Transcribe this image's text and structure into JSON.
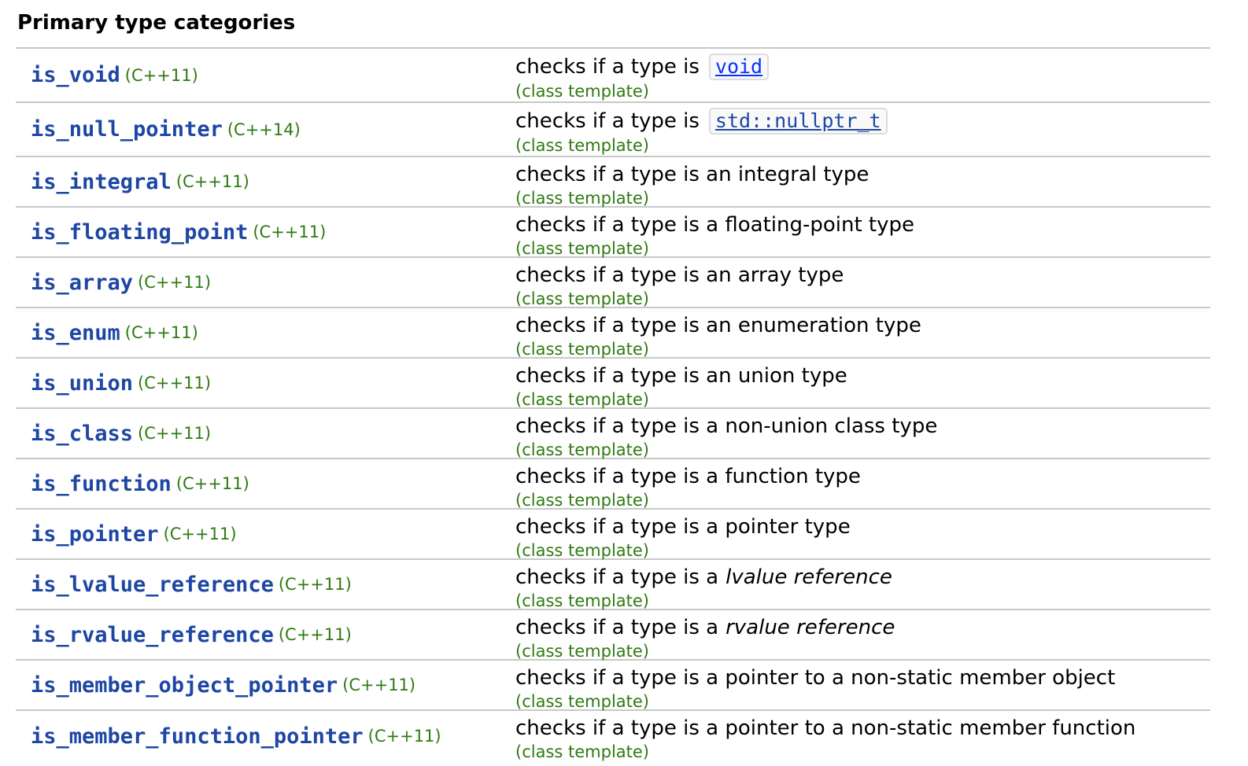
{
  "heading": "Primary type categories",
  "rows": [
    {
      "name": "is_void",
      "version": "(C++11)",
      "desc": "checks if a type is",
      "code": "void",
      "kind": "(class template)"
    },
    {
      "name": "is_null_pointer",
      "version": "(C++14)",
      "desc": "checks if a type is",
      "code": "std::nullptr_t",
      "kind": "(class template)"
    },
    {
      "name": "is_integral",
      "version": "(C++11)",
      "desc": "checks if a type is an integral type",
      "kind": "(class template)"
    },
    {
      "name": "is_floating_point",
      "version": "(C++11)",
      "desc": "checks if a type is a floating-point type",
      "kind": "(class template)"
    },
    {
      "name": "is_array",
      "version": "(C++11)",
      "desc": "checks if a type is an array type",
      "kind": "(class template)"
    },
    {
      "name": "is_enum",
      "version": "(C++11)",
      "desc": "checks if a type is an enumeration type",
      "kind": "(class template)"
    },
    {
      "name": "is_union",
      "version": "(C++11)",
      "desc": "checks if a type is an union type",
      "kind": "(class template)"
    },
    {
      "name": "is_class",
      "version": "(C++11)",
      "desc": "checks if a type is a non-union class type",
      "kind": "(class template)"
    },
    {
      "name": "is_function",
      "version": "(C++11)",
      "desc": "checks if a type is a function type",
      "kind": "(class template)"
    },
    {
      "name": "is_pointer",
      "version": "(C++11)",
      "desc": "checks if a type is a pointer type",
      "kind": "(class template)"
    },
    {
      "name": "is_lvalue_reference",
      "version": "(C++11)",
      "desc": "checks if a type is a",
      "em": "lvalue reference",
      "kind": "(class template)"
    },
    {
      "name": "is_rvalue_reference",
      "version": "(C++11)",
      "desc": "checks if a type is a",
      "em": "rvalue reference",
      "kind": "(class template)"
    },
    {
      "name": "is_member_object_pointer",
      "version": "(C++11)",
      "desc": "checks if a type is a pointer to a non-static member object",
      "kind": "(class template)"
    },
    {
      "name": "is_member_function_pointer",
      "version": "(C++11)",
      "desc": "checks if a type is a pointer to a non-static member function",
      "kind": "(class template)"
    }
  ]
}
